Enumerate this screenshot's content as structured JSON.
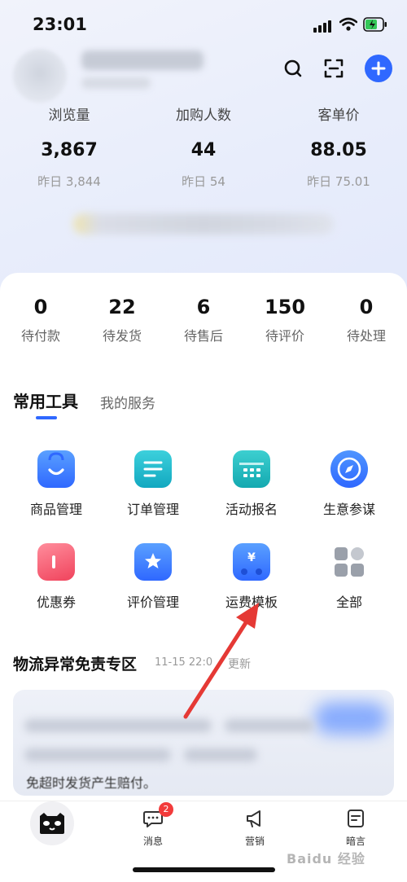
{
  "status_bar": {
    "time": "23:01"
  },
  "metrics": [
    {
      "label": "浏览量",
      "value": "3,867",
      "prev": "昨日 3,844"
    },
    {
      "label": "加购人数",
      "value": "44",
      "prev": "昨日 54"
    },
    {
      "label": "客单价",
      "value": "88.05",
      "prev": "昨日 75.01"
    }
  ],
  "orders": [
    {
      "count": "0",
      "label": "待付款"
    },
    {
      "count": "22",
      "label": "待发货"
    },
    {
      "count": "6",
      "label": "待售后"
    },
    {
      "count": "150",
      "label": "待评价"
    },
    {
      "count": "0",
      "label": "待处理"
    }
  ],
  "tabs": {
    "active": "常用工具",
    "inactive": "我的服务"
  },
  "tools": [
    {
      "label": "商品管理",
      "icon": "shopping-bag-icon",
      "color": "#2f7bff"
    },
    {
      "label": "订单管理",
      "icon": "order-list-icon",
      "color": "#1fb6c9"
    },
    {
      "label": "活动报名",
      "icon": "calendar-grid-icon",
      "color": "#19b3b8"
    },
    {
      "label": "生意参谋",
      "icon": "compass-icon",
      "color": "#2f7bff"
    },
    {
      "label": "优惠券",
      "icon": "coupon-icon",
      "color": "#f04a5e"
    },
    {
      "label": "评价管理",
      "icon": "review-star-icon",
      "color": "#2f7bff"
    },
    {
      "label": "运费模板",
      "icon": "delivery-truck-icon",
      "color": "#2f7bff"
    },
    {
      "label": "全部",
      "icon": "all-apps-icon",
      "color": "#9aa0aa"
    }
  ],
  "logistics": {
    "title": "物流异常免责专区",
    "time": "11-15 22:0",
    "update": "更新",
    "partial_text": "免超时发货产生赔付。"
  },
  "tab_bar": {
    "messages_label": "消息",
    "messages_badge": "2",
    "marketing_label": "营销",
    "notes_label": "暗言"
  },
  "watermark": "Baidu 经验"
}
